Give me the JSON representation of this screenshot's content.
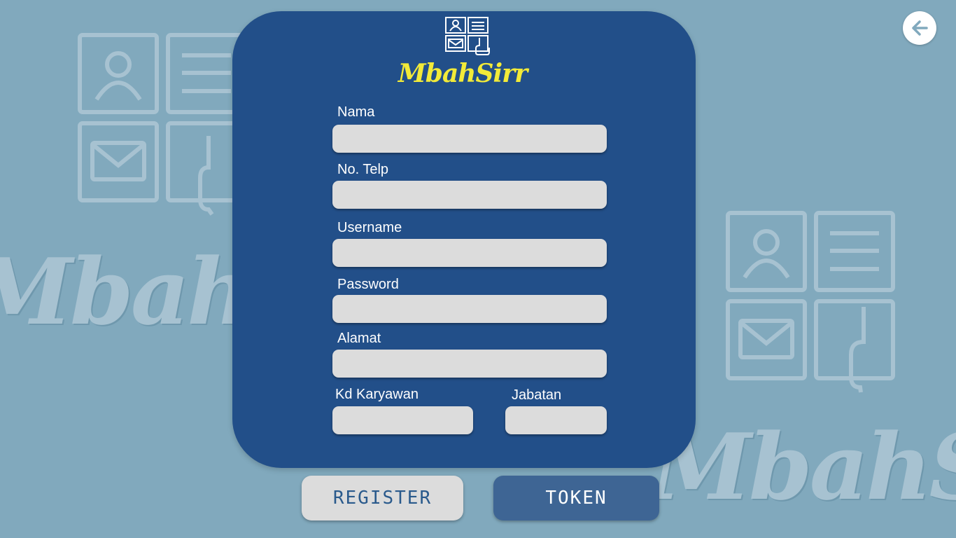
{
  "brand": {
    "name": "MbahSirr",
    "color": "#f2ea38"
  },
  "background": {
    "watermark_text": "MbahSirr",
    "color": "#81a9bd"
  },
  "card": {
    "color": "#224f89"
  },
  "form": {
    "nama": {
      "label": "Nama",
      "value": ""
    },
    "no_telp": {
      "label": "No. Telp",
      "value": ""
    },
    "username": {
      "label": "Username",
      "value": ""
    },
    "password": {
      "label": "Password",
      "value": ""
    },
    "alamat": {
      "label": "Alamat",
      "value": ""
    },
    "kd_karyawan": {
      "label": "Kd Karyawan",
      "value": ""
    },
    "jabatan": {
      "label": "Jabatan",
      "value": ""
    }
  },
  "buttons": {
    "register": "REGISTER",
    "token": "TOKEN"
  },
  "icons": {
    "back": "arrow-left-icon",
    "logo": "contact-grid-icon"
  }
}
